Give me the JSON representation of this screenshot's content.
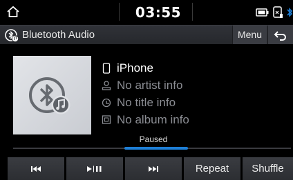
{
  "status_bar": {
    "time": "03:55",
    "icons": [
      "home-icon",
      "usb-icon",
      "phone-icon",
      "bluetooth-icon"
    ]
  },
  "header": {
    "title": "Bluetooth Audio",
    "menu_label": "Menu",
    "back_icon": "back-arrow-icon"
  },
  "now_playing": {
    "device_name": "iPhone",
    "artist": "No artist info",
    "title": "No title info",
    "album": "No album info",
    "status": "Paused",
    "progress_start": 0.4,
    "progress_end": 0.63
  },
  "controls": {
    "repeat_label": "Repeat",
    "shuffle_label": "Shuffle",
    "prev_icon": "previous-track-icon",
    "play_pause_icon": "play-pause-icon",
    "next_icon": "next-track-icon"
  },
  "colors": {
    "accent": "#1e7fd6",
    "muted_text": "#8b8d93",
    "button_bg": "#36383d"
  }
}
